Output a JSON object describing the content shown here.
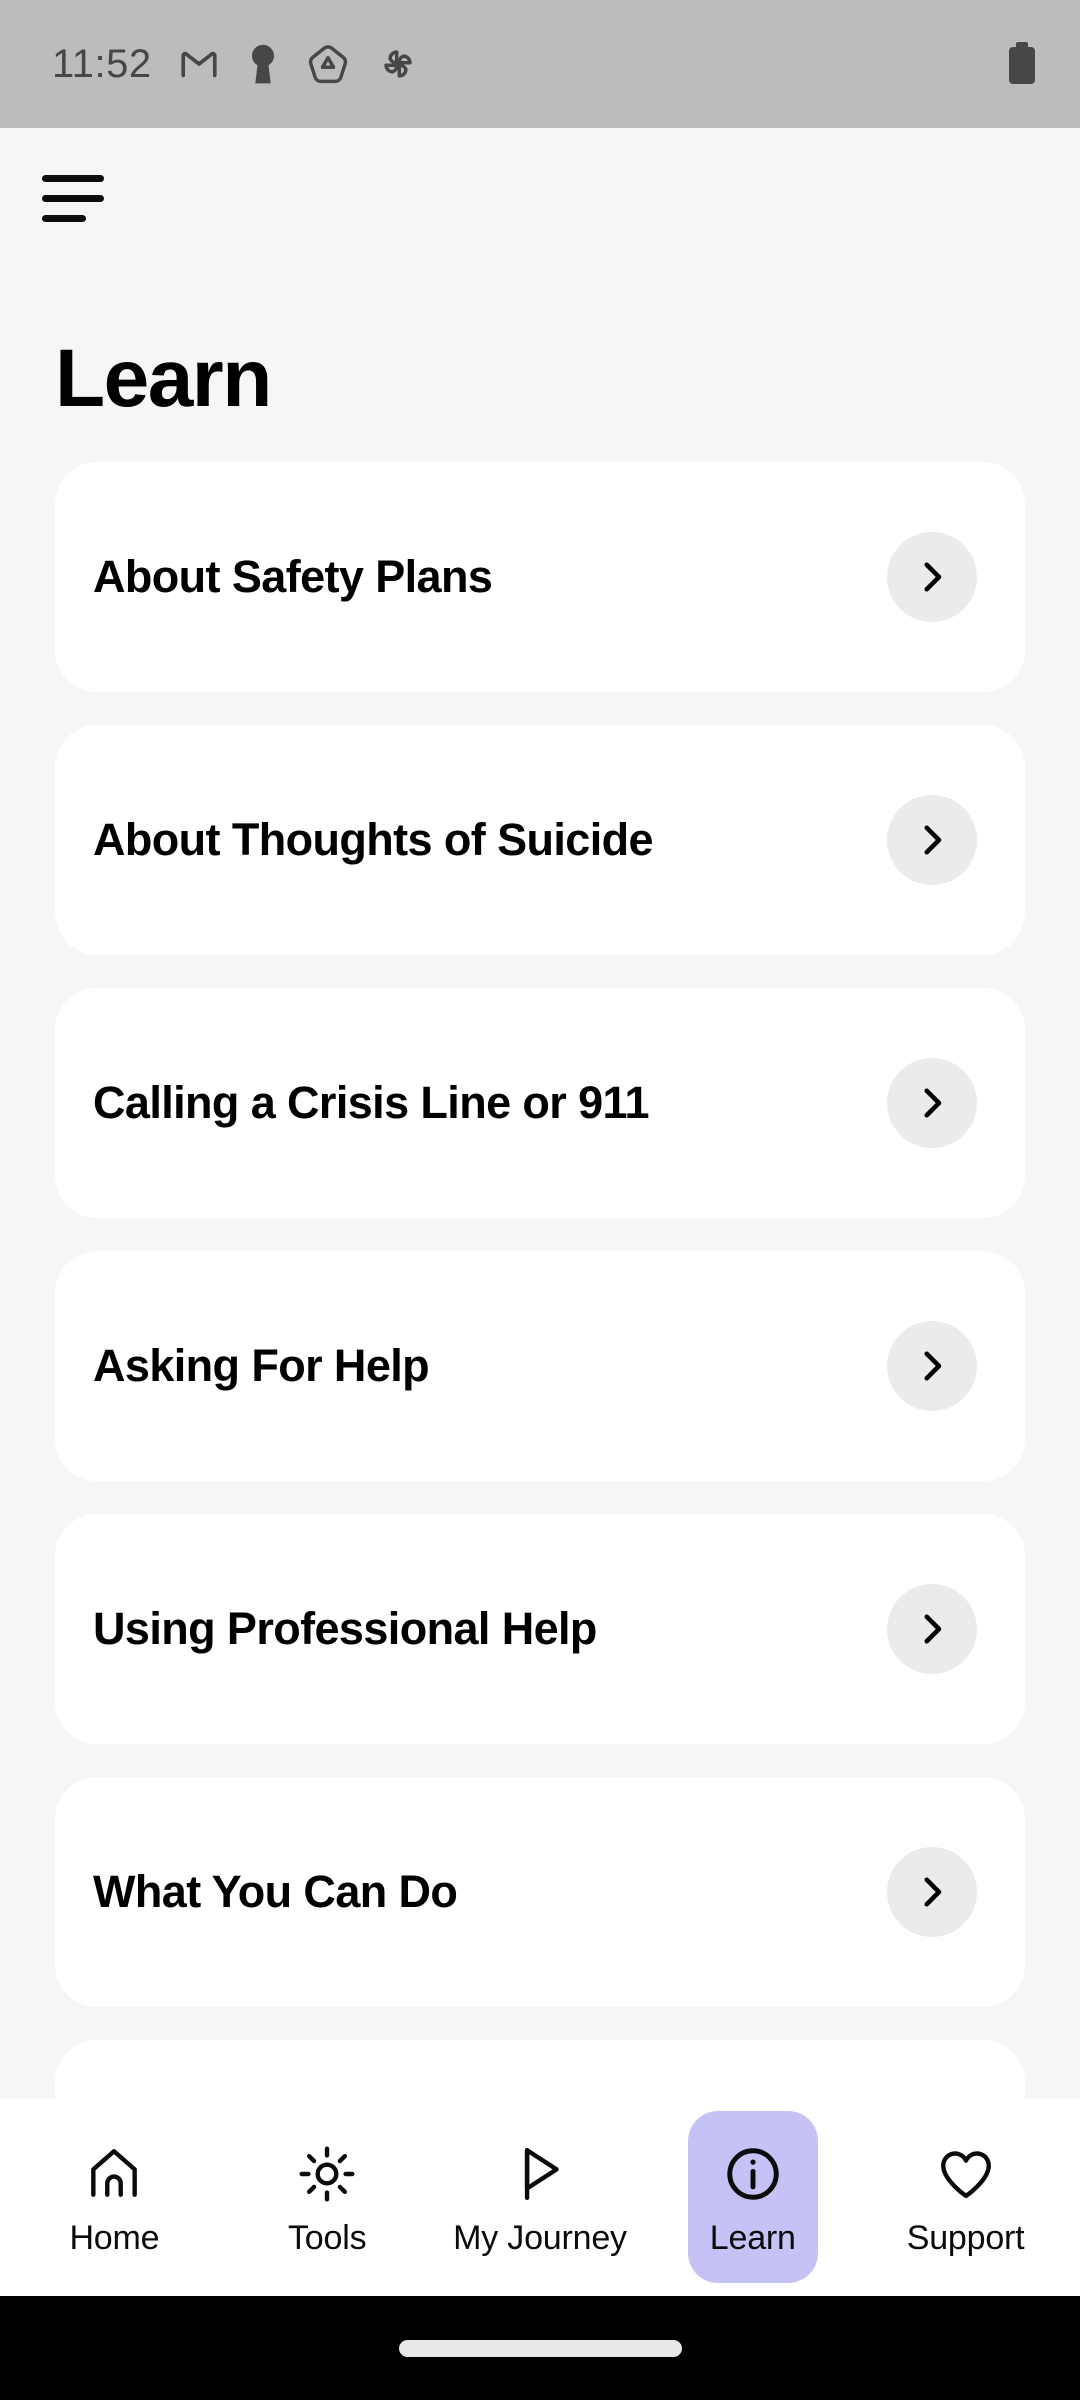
{
  "status_bar": {
    "time": "11:52",
    "left_icons": [
      {
        "name": "gmail-icon",
        "label": "Gmail"
      },
      {
        "name": "keyhole-icon",
        "label": "Keyhole"
      },
      {
        "name": "google-drive-icon",
        "label": "Drive"
      },
      {
        "name": "google-photos-icon",
        "label": "Photos"
      }
    ],
    "right_icons": [
      {
        "name": "battery-icon",
        "label": "Battery"
      }
    ],
    "background_color": "#BCBCBC",
    "foreground_color": "#474747"
  },
  "app_bar": {
    "menu_label": "Menu"
  },
  "page": {
    "title": "Learn",
    "background_color": "#F6F6F6",
    "card_color": "#FFFFFF"
  },
  "learn_list": {
    "items": [
      {
        "label": "About Safety Plans",
        "chevron": "chevron-right-icon"
      },
      {
        "label": "About Thoughts of Suicide",
        "chevron": "chevron-right-icon"
      },
      {
        "label": "Calling a Crisis Line or 911",
        "chevron": "chevron-right-icon"
      },
      {
        "label": "Asking For Help",
        "chevron": "chevron-right-icon"
      },
      {
        "label": "Using Professional Help",
        "chevron": "chevron-right-icon"
      },
      {
        "label": "What You Can Do",
        "chevron": "chevron-right-icon"
      },
      {
        "label": "",
        "chevron": "chevron-right-icon"
      }
    ],
    "chevron_button_color": "#EBEBEB"
  },
  "bottom_nav": {
    "active_index": 3,
    "active_pill_color": "#C5C2F5",
    "items": [
      {
        "label": "Home",
        "icon": "home-icon",
        "active": false
      },
      {
        "label": "Tools",
        "icon": "brightness-sun-icon",
        "active": false
      },
      {
        "label": "My Journey",
        "icon": "flag-icon",
        "active": false
      },
      {
        "label": "Learn",
        "icon": "info-circle-icon",
        "active": true
      },
      {
        "label": "Support",
        "icon": "heart-icon",
        "active": false
      }
    ]
  },
  "gesture_bar": {
    "pill_color": "#E8E8E8",
    "background_color": "#000000"
  }
}
